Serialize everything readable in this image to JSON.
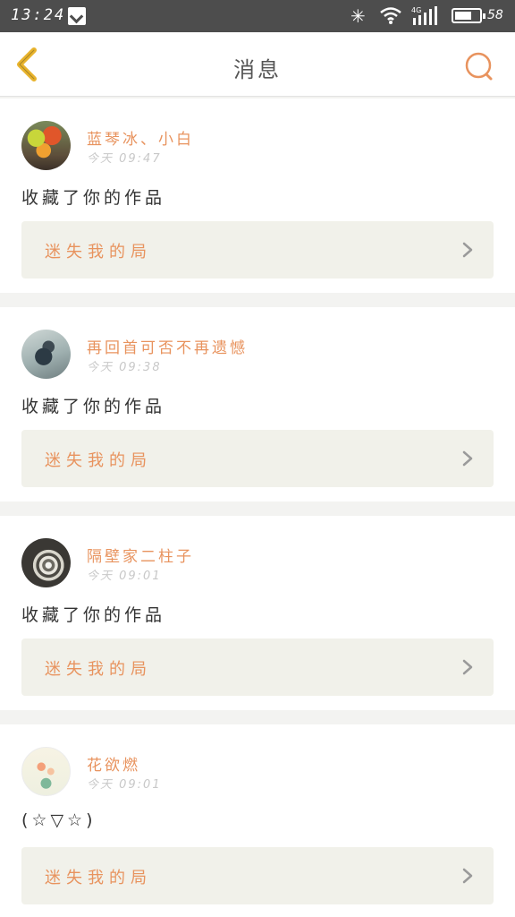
{
  "status_bar": {
    "time": "13:24",
    "battery_level": "58",
    "network": "4G",
    "icons": [
      "download-notification-icon",
      "bluetooth-icon",
      "wifi-icon",
      "signal-icon",
      "battery-icon"
    ]
  },
  "header": {
    "title": "消息",
    "back_icon": "back-chevron-icon",
    "search_icon": "search-icon",
    "accent_color": "#e8b32c"
  },
  "colors": {
    "accent_orange": "#e8935e",
    "card_bg": "#ffffff",
    "work_bg": "#f1f1ea",
    "page_bg": "#f3f3f1"
  },
  "messages": [
    {
      "username": "蓝琴冰、小白",
      "time": "今天 09:47",
      "content": "收藏了你的作品",
      "work_title": "迷失我的局"
    },
    {
      "username": "再回首可否不再遗憾",
      "time": "今天 09:38",
      "content": "收藏了你的作品",
      "work_title": "迷失我的局"
    },
    {
      "username": "隔壁家二柱子",
      "time": "今天 09:01",
      "content": "收藏了你的作品",
      "work_title": "迷失我的局"
    },
    {
      "username": "花欲燃",
      "time": "今天 09:01",
      "content": "(☆▽☆)",
      "work_title": "迷失我的局"
    }
  ]
}
